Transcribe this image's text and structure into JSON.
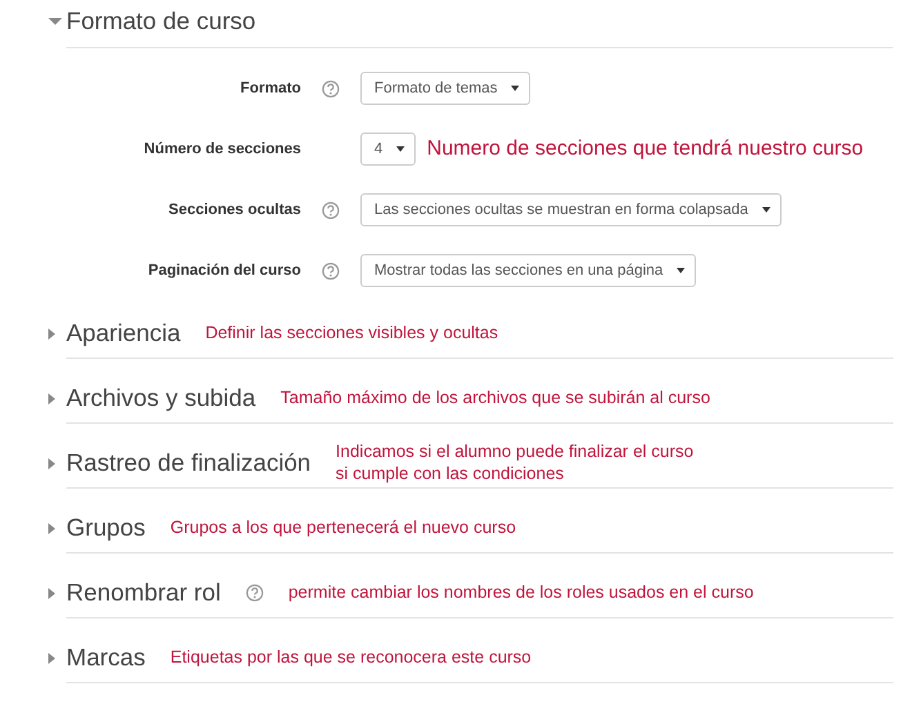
{
  "sections": [
    {
      "title": "Formato de curso",
      "expanded": true,
      "fields": [
        {
          "label": "Formato",
          "help": true,
          "value": "Formato de temas"
        },
        {
          "label": "Número de secciones",
          "value": "4",
          "annotation": "Numero de secciones que tendrá nuestro curso"
        },
        {
          "label": "Secciones ocultas",
          "help": true,
          "value": "Las secciones ocultas se muestran en forma colapsada"
        },
        {
          "label": "Paginación del curso",
          "help": true,
          "value": "Mostrar todas las secciones en una página"
        }
      ]
    },
    {
      "title": "Apariencia",
      "expanded": false,
      "annotation": [
        "Definir las secciones visibles y ocultas"
      ]
    },
    {
      "title": "Archivos y subida",
      "expanded": false,
      "annotation": [
        "Tamaño máximo de los archivos que se subirán al curso"
      ]
    },
    {
      "title": "Rastreo de finalización",
      "expanded": false,
      "annotation": [
        "Indicamos si el alumno puede finalizar el curso",
        "si cumple con las condiciones"
      ]
    },
    {
      "title": "Grupos",
      "expanded": false,
      "annotation": [
        "Grupos a los que pertenecerá el nuevo curso"
      ]
    },
    {
      "title": "Renombrar rol",
      "expanded": false,
      "help": true,
      "annotation": [
        "permite cambiar los nombres de los roles usados en el curso"
      ]
    },
    {
      "title": "Marcas",
      "expanded": false,
      "annotation": [
        "Etiquetas por las que se reconocera este curso"
      ]
    }
  ]
}
